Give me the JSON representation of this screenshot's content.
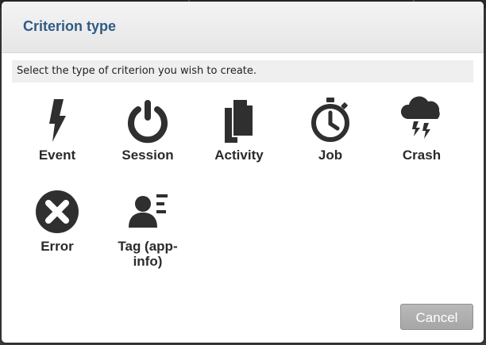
{
  "dialog": {
    "title": "Criterion type",
    "instructions": "Select the type of criterion you wish to create."
  },
  "options": [
    {
      "label": "Event",
      "icon": "lightning-bolt-icon"
    },
    {
      "label": "Session",
      "icon": "power-icon"
    },
    {
      "label": "Activity",
      "icon": "documents-icon"
    },
    {
      "label": "Job",
      "icon": "stopwatch-icon"
    },
    {
      "label": "Crash",
      "icon": "storm-cloud-icon"
    },
    {
      "label": "Error",
      "icon": "error-circle-icon"
    },
    {
      "label": "Tag (app-info)",
      "label_lines": [
        "Tag (app-",
        "info)"
      ],
      "icon": "user-tag-icon"
    }
  ],
  "buttons": {
    "cancel_label": "Cancel"
  },
  "colors": {
    "title": "#2f5b85",
    "icon": "#2f2f2f",
    "cancel_bg": "#aeaeae"
  }
}
